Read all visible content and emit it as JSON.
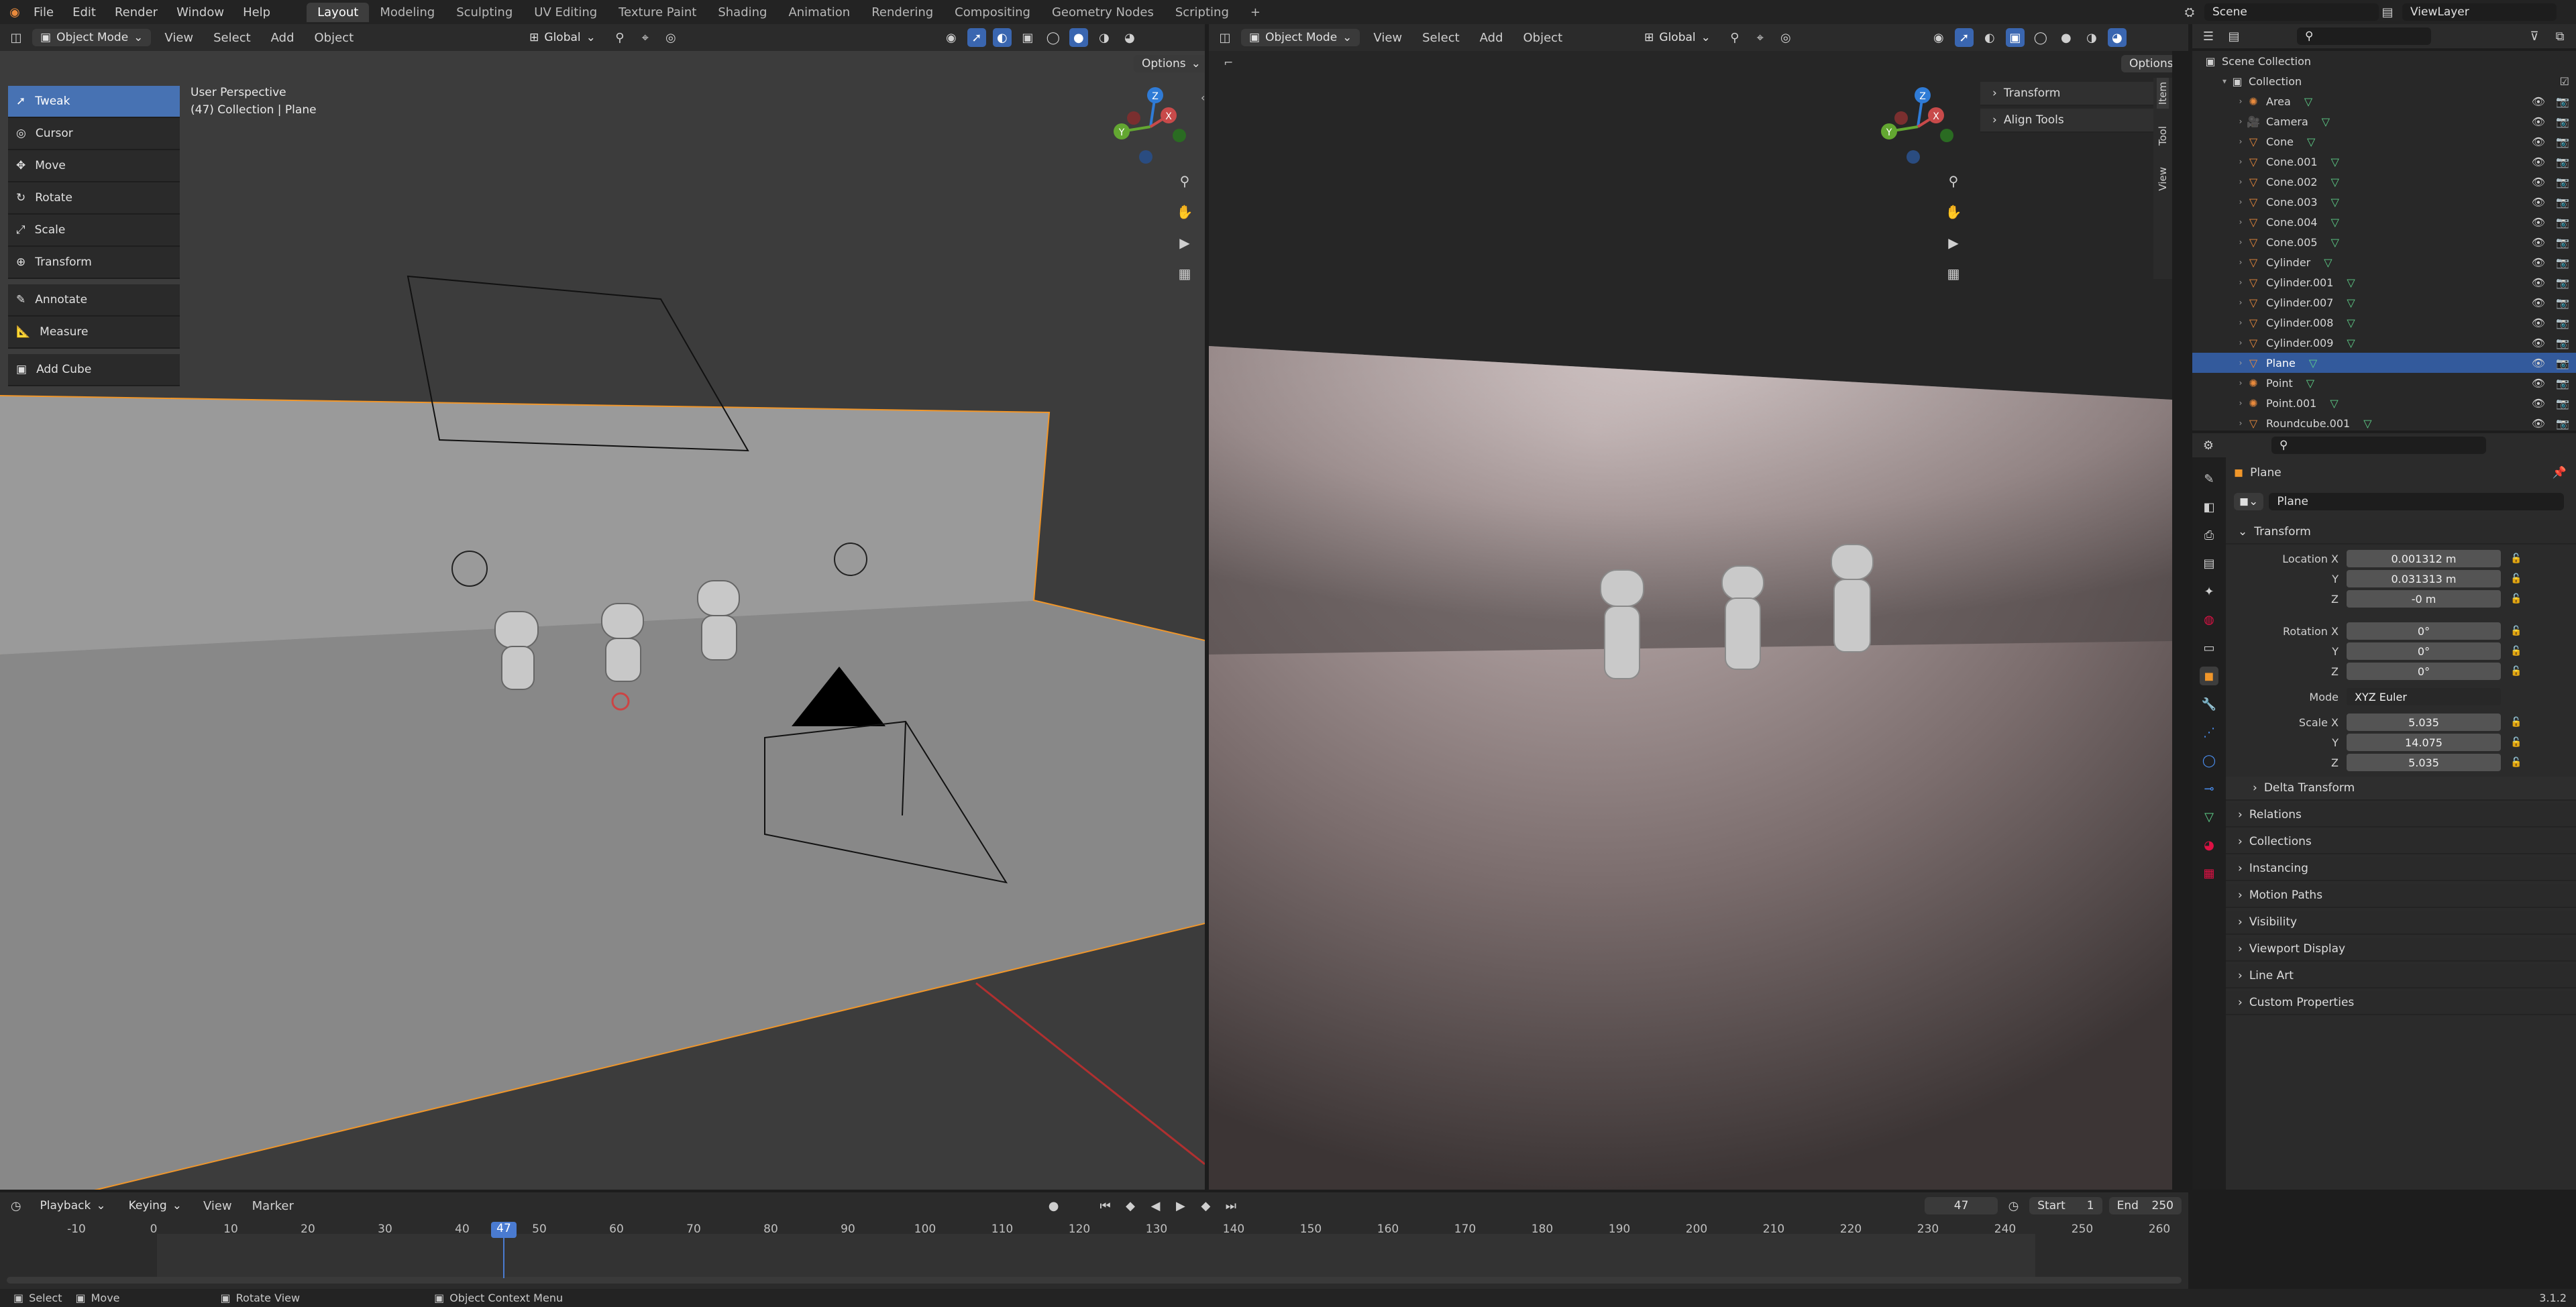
{
  "topbar": {
    "menus": [
      "File",
      "Edit",
      "Render",
      "Window",
      "Help"
    ],
    "workspaces": [
      "Layout",
      "Modeling",
      "Sculpting",
      "UV Editing",
      "Texture Paint",
      "Shading",
      "Animation",
      "Rendering",
      "Compositing",
      "Geometry Nodes",
      "Scripting"
    ],
    "active_workspace": "Layout",
    "add_tab": "+",
    "scene": "Scene",
    "view_layer": "ViewLayer"
  },
  "viewport_left": {
    "mode": "Object Mode",
    "menus": [
      "View",
      "Select",
      "Add",
      "Object"
    ],
    "orientation": "Global",
    "options": "Options",
    "info_line1": "User Perspective",
    "info_line2": "(47) Collection | Plane",
    "gizmo_axes": [
      "Z",
      "Y",
      "X"
    ]
  },
  "toolbar": {
    "tools": [
      "Tweak",
      "Cursor",
      "Move",
      "Rotate",
      "Scale",
      "Transform",
      "Annotate",
      "Measure",
      "Add Cube"
    ],
    "active_tool": "Tweak"
  },
  "viewport_right": {
    "mode": "Object Mode",
    "menus": [
      "View",
      "Select",
      "Add",
      "Object"
    ],
    "orientation": "Global",
    "options": "Options",
    "panels": [
      "Transform",
      "Align Tools"
    ],
    "side_tabs": [
      "Item",
      "Tool",
      "View"
    ],
    "gizmo_axes": [
      "Z",
      "Y",
      "X"
    ]
  },
  "outliner": {
    "root": "Scene Collection",
    "collection": "Collection",
    "items": [
      "Area",
      "Camera",
      "Cone",
      "Cone.001",
      "Cone.002",
      "Cone.003",
      "Cone.004",
      "Cone.005",
      "Cylinder",
      "Cylinder.001",
      "Cylinder.007",
      "Cylinder.008",
      "Cylinder.009",
      "Plane",
      "Point",
      "Point.001",
      "Roundcube.001"
    ],
    "selected": "Plane"
  },
  "properties": {
    "object_name": "Plane",
    "datablock": "Plane",
    "transform_title": "Transform",
    "location": {
      "label": "Location X",
      "x": "0.001312 m",
      "y": "0.031313 m",
      "z": "-0 m"
    },
    "rotation": {
      "label": "Rotation X",
      "x": "0°",
      "y": "0°",
      "z": "0°"
    },
    "mode_label": "Mode",
    "mode_value": "XYZ Euler",
    "scale": {
      "label": "Scale X",
      "x": "5.035",
      "y": "14.075",
      "z": "5.035"
    },
    "axis_y": "Y",
    "axis_z": "Z",
    "delta": "Delta Transform",
    "panels": [
      "Relations",
      "Collections",
      "Instancing",
      "Motion Paths",
      "Visibility",
      "Viewport Display",
      "Line Art",
      "Custom Properties"
    ]
  },
  "timeline": {
    "menus": [
      "Playback",
      "Keying",
      "View",
      "Marker"
    ],
    "current_frame": "47",
    "start_label": "Start",
    "start": "1",
    "end_label": "End",
    "end": "250",
    "ticks": [
      "-10",
      "0",
      "10",
      "20",
      "30",
      "40",
      "50",
      "60",
      "70",
      "80",
      "90",
      "100",
      "110",
      "120",
      "130",
      "140",
      "150",
      "160",
      "170",
      "180",
      "190",
      "200",
      "210",
      "220",
      "230",
      "240",
      "250",
      "260"
    ]
  },
  "statusbar": {
    "select": "Select",
    "move": "Move",
    "rotate_view": "Rotate View",
    "context_menu": "Object Context Menu",
    "version": "3.1.2"
  }
}
